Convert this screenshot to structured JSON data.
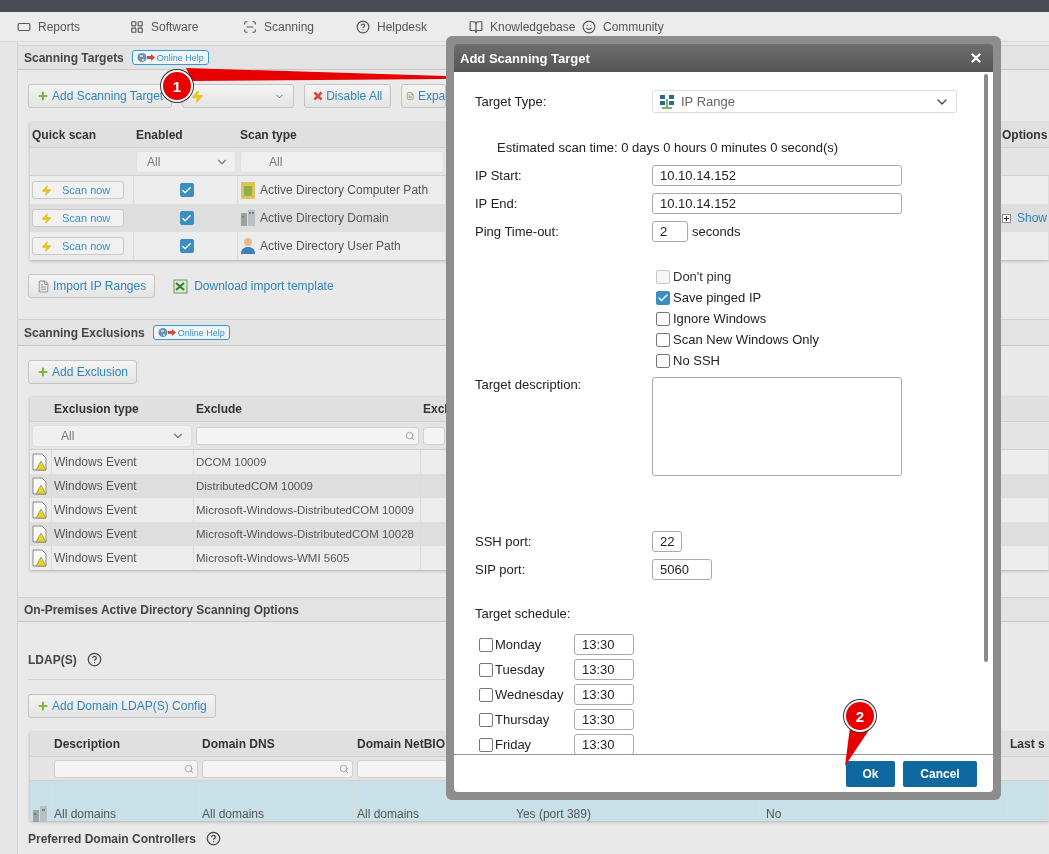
{
  "nav": [
    {
      "label": "Reports"
    },
    {
      "label": "Software"
    },
    {
      "label": "Scanning"
    },
    {
      "label": "Helpdesk"
    },
    {
      "label": "Knowledgebase"
    },
    {
      "label": "Community"
    }
  ],
  "targets": {
    "title": "Scanning Targets",
    "help": "Online Help",
    "toolbar": [
      {
        "kind": "add",
        "label": "Add Scanning Target"
      },
      {
        "kind": "scan"
      },
      {
        "kind": "disable",
        "label": "Disable All"
      },
      {
        "kind": "expand",
        "label": "Expa"
      }
    ],
    "columns": [
      "Quick scan",
      "Enabled",
      "Scan type",
      "Options"
    ],
    "filters": [
      "All",
      "All"
    ],
    "rows": [
      {
        "action": "Scan now",
        "enabled": true,
        "scan_type": "Active Directory Computer Path"
      },
      {
        "action": "Scan now",
        "enabled": true,
        "scan_type": "Active Directory Domain",
        "options": "Show"
      },
      {
        "action": "Scan now",
        "enabled": true,
        "scan_type": "Active Directory User Path"
      }
    ],
    "import": "Import IP Ranges",
    "download": "Download import template"
  },
  "exclusions": {
    "title": "Scanning Exclusions",
    "help": "Online Help",
    "add": "Add Exclusion",
    "columns": [
      "Exclusion type",
      "Exclude",
      "Excl"
    ],
    "filter": "All",
    "rows": [
      {
        "type": "Windows Event",
        "exclude": "DCOM 10009"
      },
      {
        "type": "Windows Event",
        "exclude": "DistributedCOM 10009"
      },
      {
        "type": "Windows Event",
        "exclude": "Microsoft-Windows-DistributedCOM 10009"
      },
      {
        "type": "Windows Event",
        "exclude": "Microsoft-Windows-DistributedCOM 10028"
      },
      {
        "type": "Windows Event",
        "exclude": "Microsoft-Windows-WMI 5605"
      }
    ]
  },
  "ad": {
    "title": "On-Premises Active Directory Scanning Options",
    "ldap": "LDAP(S)",
    "add": "Add Domain LDAP(S) Config",
    "columns": [
      "Description",
      "Domain DNS",
      "Domain NetBIO",
      "Last s"
    ],
    "rows": [
      {
        "selected": true,
        "cells": [
          "All domains",
          "All domains",
          "All domains",
          "Yes (port 389)",
          "No"
        ]
      }
    ],
    "next": "Preferred Domain Controllers"
  },
  "dialog": {
    "title": "Add Scanning Target",
    "target_type": {
      "label": "Target Type:",
      "value": "IP Range"
    },
    "estimate": "Estimated scan time: 0 days 0 hours 0 minutes 0 second(s)",
    "ip_start": {
      "label": "IP Start:",
      "value": "10.10.14.152"
    },
    "ip_end": {
      "label": "IP End:",
      "value": "10.10.14.152"
    },
    "ping": {
      "label": "Ping Time-out:",
      "value": "2",
      "unit": "seconds"
    },
    "options": [
      {
        "label": "Don't ping",
        "checked": false,
        "disabled": true
      },
      {
        "label": "Save pinged IP",
        "checked": true,
        "disabled": false
      },
      {
        "label": "Ignore Windows",
        "checked": false,
        "disabled": false
      },
      {
        "label": "Scan New Windows Only",
        "checked": false,
        "disabled": false
      },
      {
        "label": "No SSH",
        "checked": false,
        "disabled": false
      }
    ],
    "description": {
      "label": "Target description:"
    },
    "ssh": {
      "label": "SSH port:",
      "value": "22"
    },
    "sip": {
      "label": "SIP port:",
      "value": "5060"
    },
    "schedule": {
      "label": "Target schedule:",
      "days": [
        {
          "day": "Monday",
          "checked": false,
          "time": "13:30"
        },
        {
          "day": "Tuesday",
          "checked": false,
          "time": "13:30"
        },
        {
          "day": "Wednesday",
          "checked": false,
          "time": "13:30"
        },
        {
          "day": "Thursday",
          "checked": false,
          "time": "13:30"
        },
        {
          "day": "Friday",
          "checked": false,
          "time": "13:30"
        }
      ]
    },
    "buttons": [
      {
        "label": "Ok"
      },
      {
        "label": "Cancel"
      }
    ]
  },
  "callouts": [
    "1",
    "2"
  ]
}
